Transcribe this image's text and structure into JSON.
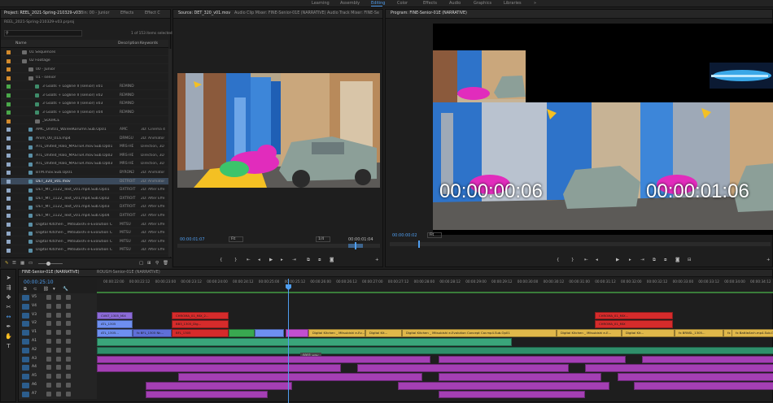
{
  "workspaces": [
    "Learning",
    "Assembly",
    "Editing",
    "Color",
    "Effects",
    "Audio",
    "Graphics",
    "Libraries"
  ],
  "workspace_active": "Editing",
  "project": {
    "tabs": [
      "Project: REEL_2021-Spring-210329-v03",
      "Bin: 00 - Junior",
      "Effects",
      "Effect C"
    ],
    "file": "REEL_2021-Spring-210329-v03.prproj",
    "selection_count": "1 of 153 items selected",
    "columns": [
      "Name",
      "Description",
      "Keywords"
    ],
    "rows": [
      {
        "name": "01 Sequences",
        "type": "folder",
        "indent": 1
      },
      {
        "name": "02 Footage",
        "type": "folder",
        "indent": 1
      },
      {
        "name": "00 - Junior",
        "type": "folder",
        "indent": 2
      },
      {
        "name": "01 - senior",
        "type": "folder",
        "indent": 2
      },
      {
        "name": "3 Goats + Logline II (senior) v01",
        "type": "seq",
        "indent": 3,
        "code": "REMIND"
      },
      {
        "name": "3 Goats + Logline II (senior) v02",
        "type": "seq",
        "indent": 3,
        "code": "REMIND"
      },
      {
        "name": "3 Goats + Logline II (senior) v03",
        "type": "seq",
        "indent": 3,
        "code": "REMIND"
      },
      {
        "name": "3 Goats + Logline II (senior) v04",
        "type": "seq",
        "indent": 3,
        "code": "REMIND"
      },
      {
        "name": "_SOURCE",
        "type": "folder",
        "indent": 3
      },
      {
        "name": "AMC_Unit01_WaTeeKorumn.Sub.Op01",
        "type": "clip",
        "indent": 2,
        "code": "AMC",
        "desc": "3D: Cinema 4"
      },
      {
        "name": "Anim_00_01a.mp4",
        "type": "clip",
        "indent": 2,
        "code": "DRMGU",
        "desc": "2D: Animator"
      },
      {
        "name": "ATL_United_Halo_MASTER.mov.Sub.Op01",
        "type": "clip",
        "indent": 2,
        "code": "MRS-HE",
        "desc": "Direction, 3D"
      },
      {
        "name": "ATL_United_Halo_MASTER.mov.Sub.Op02",
        "type": "clip",
        "indent": 2,
        "code": "MRS-HE",
        "desc": "Direction, 3D"
      },
      {
        "name": "ATL_United_Halo_MASTER.mov.Sub.Op03",
        "type": "clip",
        "indent": 2,
        "code": "MRS-HE",
        "desc": "Direction, 3D"
      },
      {
        "name": "BTM.mov.Sub.Op01",
        "type": "clip",
        "indent": 2,
        "code": "BYRON2",
        "desc": "2D: Animator"
      },
      {
        "name": "DET_320_v01.mov",
        "type": "clip",
        "indent": 2,
        "code": "DETROIT",
        "desc": "2D: Animator",
        "selected": true
      },
      {
        "name": "DET_MT_1122_Text_v01.mp4.Sub.Op01",
        "type": "clip",
        "indent": 2,
        "code": "DXTROIT",
        "desc": "2D: After Effe"
      },
      {
        "name": "DET_MT_1122_Text_v01.mp4.Sub.Op02",
        "type": "clip",
        "indent": 2,
        "code": "DXTROIT",
        "desc": "2D: After Effe"
      },
      {
        "name": "DET_MT_1122_Text_v01.mp4.Sub.Op03",
        "type": "clip",
        "indent": 2,
        "code": "DXTROIT",
        "desc": "2D: After Effe"
      },
      {
        "name": "DET_MT_1122_Text_v01.mp4.Sub.Op04",
        "type": "clip",
        "indent": 2,
        "code": "DXTROIT",
        "desc": "2D: After Effe"
      },
      {
        "name": "Digital Kitchen _ Mitsubishi e-Evolution C",
        "type": "clip",
        "indent": 2,
        "code": "MITSU",
        "desc": "3D: After Effe"
      },
      {
        "name": "Digital Kitchen _ Mitsubishi e-Evolution C",
        "type": "clip",
        "indent": 2,
        "code": "MITSU",
        "desc": "3D: After Effe"
      },
      {
        "name": "Digital Kitchen _ Mitsubishi e-Evolution C",
        "type": "clip",
        "indent": 2,
        "code": "MITSU",
        "desc": "3D: After Effe"
      },
      {
        "name": "Digital Kitchen _ Mitsubishi e-Evolution C",
        "type": "clip",
        "indent": 2,
        "code": "MITSU",
        "desc": "3D: After Effe"
      }
    ]
  },
  "source": {
    "tabs": [
      "Source: DET_320_v01.mov",
      "Audio Clip Mixer: FINE-Senior-01E (NARRATIVE)",
      "Audio Track Mixer: FINE-Se"
    ],
    "timecode": "00:00:01:07",
    "fit": "Fit",
    "resolution": "1/4",
    "duration": "00:00:01:04"
  },
  "program": {
    "tab": "Program: FINE-Senior-01E (NARRATIVE)",
    "timecode": "00:00:00:02",
    "fit": "Fit",
    "overlay_tc_1": "00:00:00:06",
    "overlay_tc_2": "00:00:01:06"
  },
  "timeline": {
    "tabs": [
      "FINE-Senior-01E (NARRATIVE)",
      "ROUGH-Senior-01E (NARRATIVE)"
    ],
    "timecode": "00:00:25:10",
    "ruler": [
      "00:00:22:00",
      "00:00:22:12",
      "00:00:23:00",
      "00:00:23:12",
      "00:00:24:00",
      "00:00:24:12",
      "00:00:25:00",
      "00:00:25:12",
      "00:00:26:00",
      "00:00:26:12",
      "00:00:27:00",
      "00:00:27:12",
      "00:00:28:00",
      "00:00:28:12",
      "00:00:29:00",
      "00:00:29:12",
      "00:00:30:00",
      "00:00:30:12",
      "00:00:31:00",
      "00:00:31:12",
      "00:00:32:00",
      "00:00:32:12",
      "00:00:33:00",
      "00:00:33:12",
      "00:00:34:00",
      "00:00:34:12"
    ],
    "video_tracks": [
      "V5",
      "V4",
      "V3",
      "V2",
      "V1"
    ],
    "audio_tracks": [
      "A1",
      "A2",
      "A3",
      "A4",
      "A5",
      "A6",
      "A7"
    ],
    "clip_labels": {
      "v3a": "CVNT_1305_MIX",
      "v3b": "CHROMA_01_MIX_2...",
      "v3c": "CHROMA_01_MIX...",
      "v2a": "ATL_1305",
      "v2b": "BB3_1305_Dig...",
      "v2c": "CHROMA_01_MIX",
      "v1": [
        "ATL_1305...",
        "fx BFL_1305 Nk...",
        "BFL_1305",
        "Digital Kitchen _ Mitsubishi e-Ev...",
        "Digital Kit...",
        "Digital Kitchen _ Mitsubishi e-Evolution Concept Car.mp4.Sub.Op01",
        "Digital Kitchen _ Mitsubishi e-E...",
        "Digital Kit...",
        "fx BRNSL_1305...",
        "fx Redfin.mp4.Sub.Op01",
        "fx BattleArch.mp4.Sub.Op02"
      ],
      "a1_tip": "0001.wav"
    }
  },
  "colors": {
    "accent": "#4f9ef0",
    "violet_clip": "#8c6bd8",
    "red_clip": "#d62b2b",
    "yellow_clip": "#e0b84a",
    "green_audio": "#3aa57a",
    "magenta_audio": "#a43fb4"
  }
}
